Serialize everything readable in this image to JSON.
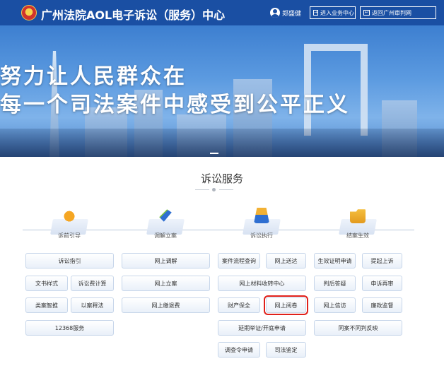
{
  "header": {
    "title": "广州法院AOL电子诉讼（服务）中心",
    "user_name": "郑盛健",
    "business_center_label": "进入业务中心",
    "back_label": "返回广州审判网"
  },
  "banner": {
    "slogan_line1": "努力让人民群众在",
    "slogan_line2": "每一个司法案件中感受到公平正义"
  },
  "section": {
    "title": "诉讼服务",
    "categories": [
      {
        "label": "诉前引导"
      },
      {
        "label": "调解立案"
      },
      {
        "label": "诉讼执行"
      },
      {
        "label": "结案生效"
      }
    ],
    "buttons": [
      {
        "label": "诉讼指引"
      },
      {
        "label": "文书样式"
      },
      {
        "label": "诉讼费计算"
      },
      {
        "label": "类案智推"
      },
      {
        "label": "以案释法"
      },
      {
        "label": "12368服务"
      },
      {
        "label": "网上调解"
      },
      {
        "label": "网上立案"
      },
      {
        "label": "网上缴退费"
      },
      {
        "label": "案件流程查询"
      },
      {
        "label": "网上送达"
      },
      {
        "label": "网上材料收转中心"
      },
      {
        "label": "财产保全"
      },
      {
        "label": "网上阅卷"
      },
      {
        "label": "延期举证/开庭申请"
      },
      {
        "label": "调查令申请"
      },
      {
        "label": "司法鉴定"
      },
      {
        "label": "生效证明申请"
      },
      {
        "label": "提起上诉"
      },
      {
        "label": "判后答疑"
      },
      {
        "label": "申诉再审"
      },
      {
        "label": "网上信访"
      },
      {
        "label": "廉政监督"
      },
      {
        "label": "同案不同判反映"
      }
    ]
  },
  "colors": {
    "header_bg": "#1a4fa3",
    "highlight_border": "#e0201a"
  }
}
